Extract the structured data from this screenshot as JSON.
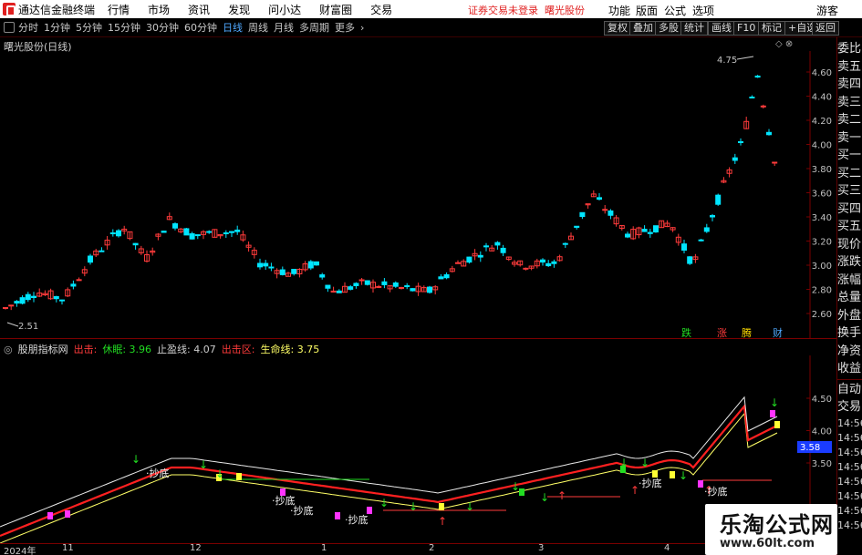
{
  "menubar": {
    "app_title": "通达信金融终端",
    "items": [
      "行情",
      "市场",
      "资讯",
      "发现",
      "问小达",
      "财富圈",
      "交易"
    ],
    "notice": "证券交易未登录",
    "stock": "曙光股份",
    "right_items": [
      "功能",
      "版面",
      "公式",
      "选项"
    ],
    "guest": "游客"
  },
  "toolbar": {
    "periods": [
      "分时",
      "1分钟",
      "5分钟",
      "15分钟",
      "30分钟",
      "60分钟",
      "日线",
      "周线",
      "月线",
      "多周期",
      "更多"
    ],
    "active": "日线",
    "buttons": [
      "复权",
      "叠加",
      "多股",
      "统计",
      "画线",
      "F10",
      "标记",
      "+自选",
      "返回"
    ]
  },
  "main_chart": {
    "title": "曙光股份(日线)",
    "price_ticks": [
      "4.60",
      "4.40",
      "4.20",
      "4.00",
      "3.80",
      "3.60",
      "3.40",
      "3.20",
      "3.00",
      "2.80",
      "2.60"
    ],
    "high_label": "4.75",
    "low_label": "2.51",
    "markers": [
      "跌",
      "涨",
      "腾",
      "财"
    ]
  },
  "indicator": {
    "name": "股朋指标网",
    "out": "出击:",
    "rest_label": "休眠:",
    "rest_value": "3.96",
    "stop_label": "止盈线:",
    "stop_value": "4.07",
    "zone_label": "出击区:",
    "life_label": "生命线:",
    "life_value": "3.75",
    "ticks": [
      "4.50",
      "4.00",
      "3.50"
    ],
    "current": "3.58",
    "chaodi": "抄底"
  },
  "xaxis": [
    "2024年",
    "11",
    "12",
    "1",
    "2",
    "3",
    "4"
  ],
  "right_panel": {
    "items": [
      "委比",
      "卖五",
      "卖四",
      "卖三",
      "卖二",
      "卖一",
      "买一",
      "买二",
      "买三",
      "买四",
      "买五",
      "现价",
      "涨跌",
      "涨幅",
      "总量",
      "外盘",
      "换手",
      "净资",
      "收益"
    ],
    "auto": "自动",
    "trade": "交易",
    "times": [
      "14:56",
      "14:56",
      "14:56",
      "14:56",
      "14:56",
      "14:56",
      "14:56",
      "14:56",
      "14:56"
    ]
  },
  "colors": {
    "up": "#ff3b3b",
    "down": "#00e5ff",
    "grid": "#7a0000",
    "ma_red": "#ff2020",
    "ma_white": "#e8e8e8",
    "ma_yellow": "#ffff66",
    "accent_blue": "#4fa8ff"
  },
  "watermark": {
    "title": "乐淘公式网",
    "url": "www.60lt.com"
  }
}
